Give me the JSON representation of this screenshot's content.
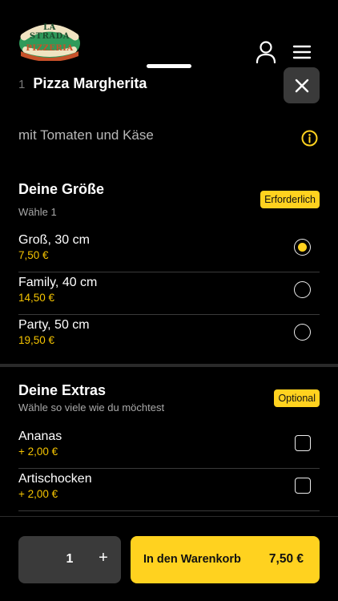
{
  "header": {
    "logo_text_top": "LA STRADA",
    "logo_text_bottom": "PIZZERIA",
    "user_icon": "user-icon",
    "menu_icon": "hamburger-menu-icon"
  },
  "product": {
    "quantity_prefix": "1",
    "name": "Pizza Margherita",
    "description": "mit Tomaten und Käse",
    "close_icon": "close-icon",
    "info_icon": "info-icon"
  },
  "size_section": {
    "title": "Deine Größe",
    "subtitle": "Wähle 1",
    "badge": "Erforderlich",
    "options": [
      {
        "name": "Groß, 30 cm",
        "price": "7,50 €",
        "selected": true
      },
      {
        "name": "Family, 40 cm",
        "price": "14,50 €",
        "selected": false
      },
      {
        "name": "Party, 50 cm",
        "price": "19,50 €",
        "selected": false
      }
    ]
  },
  "extras_section": {
    "title": "Deine Extras",
    "subtitle": "Wähle so viele wie du möchtest",
    "badge": "Optional",
    "options": [
      {
        "name": "Ananas",
        "price": "+ 2,00 €",
        "checked": false
      },
      {
        "name": "Artischocken",
        "price": "+ 2,00 €",
        "checked": false
      }
    ]
  },
  "footer": {
    "quantity": "1",
    "plus_label": "+",
    "add_to_cart_label": "In den Warenkorb",
    "total_price": "7,50 €"
  },
  "colors": {
    "accent": "#ffd21f",
    "background": "#000000",
    "price": "#f5c400"
  }
}
